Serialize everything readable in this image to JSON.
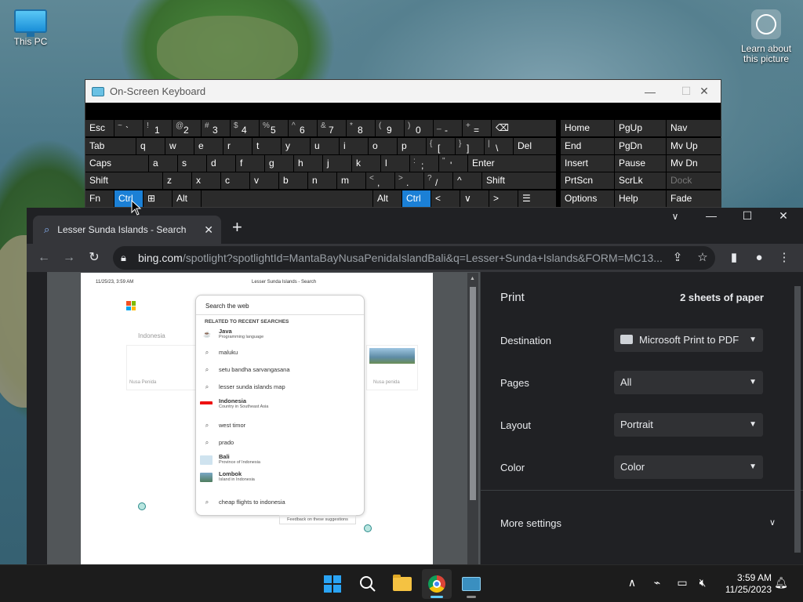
{
  "desktop": {
    "icons": [
      {
        "label": "This PC"
      },
      {
        "label": "Learn about this picture"
      }
    ]
  },
  "osk": {
    "title": "On-Screen Keyboard",
    "rows": [
      [
        {
          "sub": "",
          "main": "Esc"
        },
        {
          "sub": "~",
          "main": "`"
        },
        {
          "sub": "!",
          "main": "1"
        },
        {
          "sub": "@",
          "main": "2"
        },
        {
          "sub": "#",
          "main": "3"
        },
        {
          "sub": "$",
          "main": "4"
        },
        {
          "sub": "%",
          "main": "5"
        },
        {
          "sub": "^",
          "main": "6"
        },
        {
          "sub": "&",
          "main": "7"
        },
        {
          "sub": "*",
          "main": "8"
        },
        {
          "sub": "(",
          "main": "9"
        },
        {
          "sub": ")",
          "main": "0"
        },
        {
          "sub": "_",
          "main": "-"
        },
        {
          "sub": "+",
          "main": "="
        },
        {
          "sub": "",
          "main": "⌫"
        },
        {
          "sub": "",
          "main": "Home"
        },
        {
          "sub": "",
          "main": "PgUp"
        },
        {
          "sub": "",
          "main": "Nav"
        }
      ],
      [
        {
          "sub": "",
          "main": "Tab"
        },
        {
          "sub": "",
          "main": "q"
        },
        {
          "sub": "",
          "main": "w"
        },
        {
          "sub": "",
          "main": "e"
        },
        {
          "sub": "",
          "main": "r"
        },
        {
          "sub": "",
          "main": "t"
        },
        {
          "sub": "",
          "main": "y"
        },
        {
          "sub": "",
          "main": "u"
        },
        {
          "sub": "",
          "main": "i"
        },
        {
          "sub": "",
          "main": "o"
        },
        {
          "sub": "",
          "main": "p"
        },
        {
          "sub": "{",
          "main": "["
        },
        {
          "sub": "}",
          "main": "]"
        },
        {
          "sub": "|",
          "main": "\\"
        },
        {
          "sub": "",
          "main": "Del"
        },
        {
          "sub": "",
          "main": "End"
        },
        {
          "sub": "",
          "main": "PgDn"
        },
        {
          "sub": "",
          "main": "Mv Up"
        }
      ],
      [
        {
          "sub": "",
          "main": "Caps"
        },
        {
          "sub": "",
          "main": "a"
        },
        {
          "sub": "",
          "main": "s"
        },
        {
          "sub": "",
          "main": "d"
        },
        {
          "sub": "",
          "main": "f"
        },
        {
          "sub": "",
          "main": "g"
        },
        {
          "sub": "",
          "main": "h"
        },
        {
          "sub": "",
          "main": "j"
        },
        {
          "sub": "",
          "main": "k"
        },
        {
          "sub": "",
          "main": "l"
        },
        {
          "sub": ":",
          "main": ";"
        },
        {
          "sub": "\"",
          "main": "'"
        },
        {
          "sub": "",
          "main": "Enter"
        },
        {
          "sub": "",
          "main": "Insert"
        },
        {
          "sub": "",
          "main": "Pause"
        },
        {
          "sub": "",
          "main": "Mv Dn"
        }
      ],
      [
        {
          "sub": "",
          "main": "Shift"
        },
        {
          "sub": "",
          "main": "z"
        },
        {
          "sub": "",
          "main": "x"
        },
        {
          "sub": "",
          "main": "c"
        },
        {
          "sub": "",
          "main": "v"
        },
        {
          "sub": "",
          "main": "b"
        },
        {
          "sub": "",
          "main": "n"
        },
        {
          "sub": "",
          "main": "m"
        },
        {
          "sub": "<",
          "main": ","
        },
        {
          "sub": ">",
          "main": "."
        },
        {
          "sub": "?",
          "main": "/"
        },
        {
          "sub": "",
          "main": "^"
        },
        {
          "sub": "",
          "main": "Shift"
        },
        {
          "sub": "",
          "main": "PrtScn"
        },
        {
          "sub": "",
          "main": "ScrLk"
        },
        {
          "sub": "",
          "main": "Dock"
        }
      ],
      [
        {
          "sub": "",
          "main": "Fn"
        },
        {
          "sub": "",
          "main": "Ctrl"
        },
        {
          "sub": "",
          "main": "⊞"
        },
        {
          "sub": "",
          "main": "Alt"
        },
        {
          "sub": "",
          "main": ""
        },
        {
          "sub": "",
          "main": "Alt"
        },
        {
          "sub": "",
          "main": "Ctrl"
        },
        {
          "sub": "",
          "main": "<"
        },
        {
          "sub": "",
          "main": "∨"
        },
        {
          "sub": "",
          "main": ">"
        },
        {
          "sub": "",
          "main": "☰"
        },
        {
          "sub": "",
          "main": "Options"
        },
        {
          "sub": "",
          "main": "Help"
        },
        {
          "sub": "",
          "main": "Fade"
        }
      ]
    ]
  },
  "browser": {
    "tab_title": "Lesser Sunda Islands - Search",
    "url_host": "bing.com",
    "url_path": "/spotlight?spotlightId=MantaBayNusaPenidaIslandBali&q=Lesser+Sunda+Islands&FORM=MC13..."
  },
  "preview": {
    "date": "11/25/23, 3:59 AM",
    "page_title": "Lesser Sunda Islands - Search",
    "faint": [
      "Indonesia",
      "Nusa Penida",
      "Nusa penida"
    ],
    "search_placeholder": "Search the web",
    "related_heading": "RELATED TO RECENT SEARCHES",
    "suggestions": [
      {
        "main": "Java",
        "sub": "Programming language",
        "icon": "java-icon"
      },
      {
        "main": "maluku",
        "sub": "",
        "icon": "search-icon"
      },
      {
        "main": "setu bandha sarvangasana",
        "sub": "",
        "icon": "search-icon"
      },
      {
        "main": "lesser sunda islands map",
        "sub": "",
        "icon": "search-icon"
      },
      {
        "main": "Indonesia",
        "sub": "Country in Southeast Asia",
        "icon": "flag-icon"
      },
      {
        "main": "west timor",
        "sub": "",
        "icon": "search-icon"
      },
      {
        "main": "prado",
        "sub": "",
        "icon": "search-icon"
      },
      {
        "main": "Bali",
        "sub": "Province of Indonesia",
        "icon": "map-icon"
      },
      {
        "main": "Lombok",
        "sub": "Island in Indonesia",
        "icon": "photo-icon"
      },
      {
        "main": "cheap flights to indonesia",
        "sub": "",
        "icon": "search-icon"
      }
    ],
    "feedback": "Feedback on these suggestions"
  },
  "print": {
    "heading": "Print",
    "sheets": "2 sheets of paper",
    "destination_label": "Destination",
    "destination_value": "Microsoft Print to PDF",
    "pages_label": "Pages",
    "pages_value": "All",
    "layout_label": "Layout",
    "layout_value": "Portrait",
    "color_label": "Color",
    "color_value": "Color",
    "more_settings": "More settings"
  },
  "taskbar": {
    "time": "3:59 AM",
    "date": "11/25/2023"
  }
}
